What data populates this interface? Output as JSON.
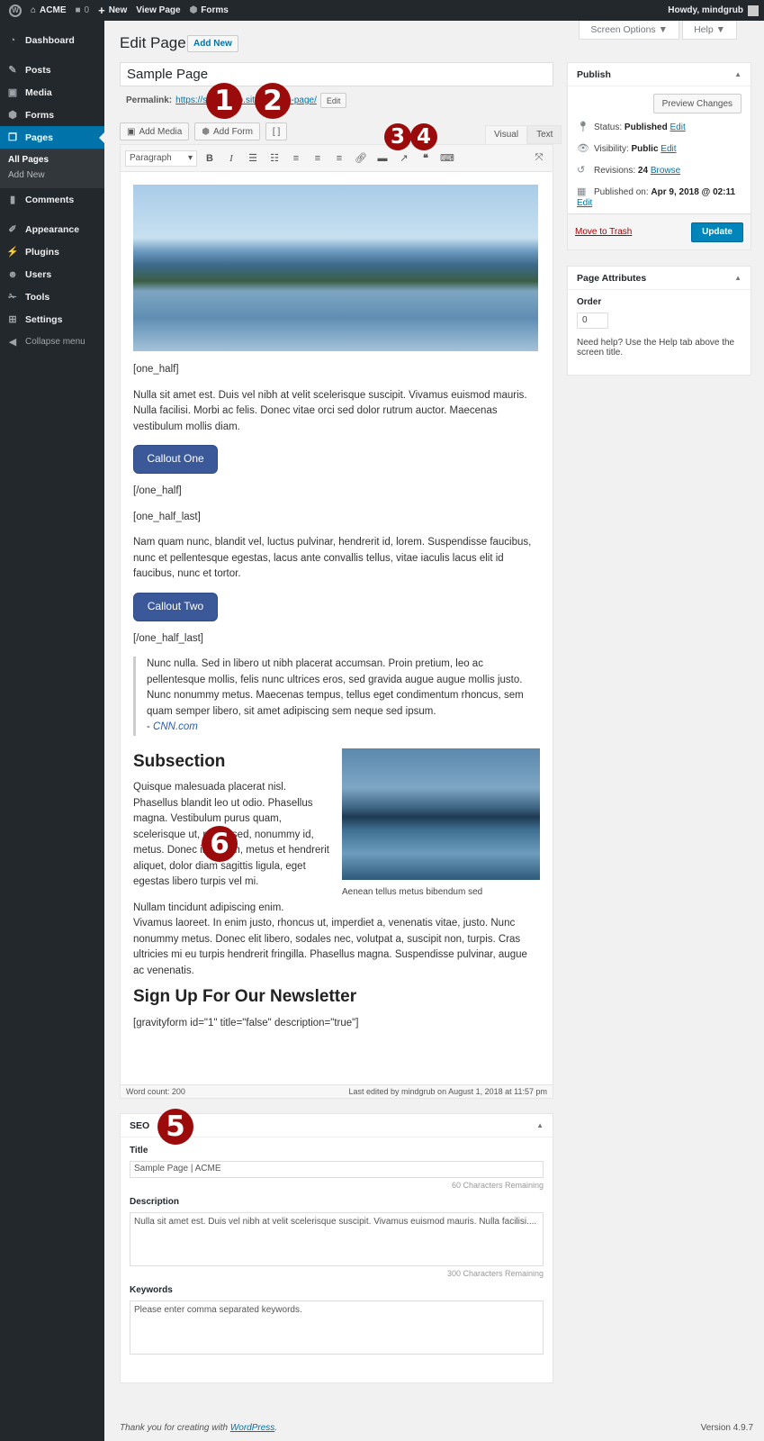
{
  "adminbar": {
    "site_name": "ACME",
    "comments_count": "0",
    "new_label": "New",
    "view_page_label": "View Page",
    "forms_label": "Forms",
    "howdy": "Howdy, mindgrub"
  },
  "sidebar": {
    "items": [
      {
        "label": "Dashboard",
        "icon": "dashboard-icon"
      },
      {
        "label": "Posts",
        "icon": "pin-icon"
      },
      {
        "label": "Media",
        "icon": "media-icon"
      },
      {
        "label": "Forms",
        "icon": "forms-icon"
      },
      {
        "label": "Pages",
        "icon": "pages-icon"
      },
      {
        "label": "Comments",
        "icon": "comment-icon"
      },
      {
        "label": "Appearance",
        "icon": "brush-icon"
      },
      {
        "label": "Plugins",
        "icon": "plugin-icon"
      },
      {
        "label": "Users",
        "icon": "user-icon"
      },
      {
        "label": "Tools",
        "icon": "wrench-icon"
      },
      {
        "label": "Settings",
        "icon": "settings-icon"
      }
    ],
    "submenu": [
      "All Pages",
      "Add New"
    ],
    "collapse_label": "Collapse menu"
  },
  "header": {
    "screen_options": "Screen Options ▼",
    "help": "Help ▼",
    "title": "Edit Page",
    "add_new": "Add New"
  },
  "editor": {
    "post_title": "Sample Page",
    "permalink_label": "Permalink:",
    "permalink_url": "https://s…rdp…o.site/sample-page/",
    "permalink_edit": "Edit",
    "add_media": "Add Media",
    "add_form": "Add Form",
    "shortcode_btn": "[ ]",
    "tab_visual": "Visual",
    "tab_text": "Text",
    "format_select": "Paragraph",
    "word_count": "Word count: 200",
    "last_edited": "Last edited by mindgrub on August 1, 2018 at 11:57 pm"
  },
  "content": {
    "one_half_open": "[one_half]",
    "para1": "Nulla sit amet est. Duis vel nibh at velit scelerisque suscipit. Vivamus euismod mauris. Nulla facilisi. Morbi ac felis. Donec vitae orci sed dolor rutrum auctor. Maecenas vestibulum mollis diam.",
    "callout_one": "Callout One",
    "one_half_close": "[/one_half]",
    "one_half_last_open": "[one_half_last]",
    "para2": "Nam quam nunc, blandit vel, luctus pulvinar, hendrerit id, lorem. Suspendisse faucibus, nunc et pellentesque egestas, lacus ante convallis tellus, vitae iaculis lacus elit id faucibus, nunc et tortor.",
    "callout_two": "Callout Two",
    "one_half_last_close": "[/one_half_last]",
    "quote": "Nunc nulla. Sed in libero ut nibh placerat accumsan. Proin pretium, leo ac pellentesque mollis, felis nunc ultrices eros, sed gravida augue augue mollis justo. Nunc nonummy metus. Maecenas tempus, tellus eget condimentum rhoncus, sem quam semper libero, sit amet adipiscing sem neque sed ipsum.",
    "quote_dash": "- ",
    "quote_source": "CNN.com",
    "subsection_heading": "Subsection",
    "subsection_text": "Quisque malesuada placerat nisl. Phasellus blandit leo ut odio. Phasellus magna. Vestibulum purus quam, scelerisque ut, mollis sed, nonummy id, metus. Donec interdum, metus et hendrerit aliquet, dolor diam sagittis ligula, eget egestas libero turpis vel mi.",
    "image_caption": "Aenean tellus metus bibendum sed",
    "para3_line1": "Nullam tincidunt adipiscing enim.",
    "para3_rest": "Vivamus laoreet. In enim justo, rhoncus ut, imperdiet a, venenatis vitae, justo. Nunc nonummy metus. Donec elit libero, sodales nec, volutpat a, suscipit non, turpis. Cras ultricies mi eu turpis hendrerit fringilla. Phasellus magna. Suspendisse pulvinar, augue ac venenatis.",
    "newsletter_heading": "Sign Up For Our Newsletter",
    "gravityform": "[gravityform id=\"1\" title=\"false\" description=\"true\"]"
  },
  "seo": {
    "heading": "SEO",
    "title_label": "Title",
    "title_value": "Sample Page | ACME",
    "title_remaining": "60 Characters Remaining",
    "description_label": "Description",
    "description_value": "Nulla sit amet est. Duis vel nibh at velit scelerisque suscipit. Vivamus euismod mauris. Nulla facilisi....",
    "description_remaining": "300 Characters Remaining",
    "keywords_label": "Keywords",
    "keywords_placeholder": "Please enter comma separated keywords."
  },
  "publish": {
    "heading": "Publish",
    "preview": "Preview Changes",
    "status_label": "Status:",
    "status_value": "Published",
    "visibility_label": "Visibility:",
    "visibility_value": "Public",
    "revisions_label": "Revisions:",
    "revisions_value": "24",
    "browse": "Browse",
    "published_on_label": "Published on:",
    "published_on_value": "Apr 9, 2018 @ 02:11",
    "edit": "Edit",
    "trash": "Move to Trash",
    "update": "Update"
  },
  "attributes": {
    "heading": "Page Attributes",
    "order_label": "Order",
    "order_value": "0",
    "help_text": "Need help? Use the Help tab above the screen title."
  },
  "footer": {
    "thanks_prefix": "Thank you for creating with ",
    "wordpress_link": "WordPress",
    "thanks_suffix": ".",
    "version": "Version 4.9.7"
  },
  "markers": [
    "1",
    "2",
    "3",
    "4",
    "5",
    "6"
  ],
  "colors": {
    "admin_bar": "#23282d",
    "active_menu": "#0073aa",
    "update_button": "#0085ba",
    "callout_button": "#3b5998",
    "marker": "#9c0b0b"
  }
}
